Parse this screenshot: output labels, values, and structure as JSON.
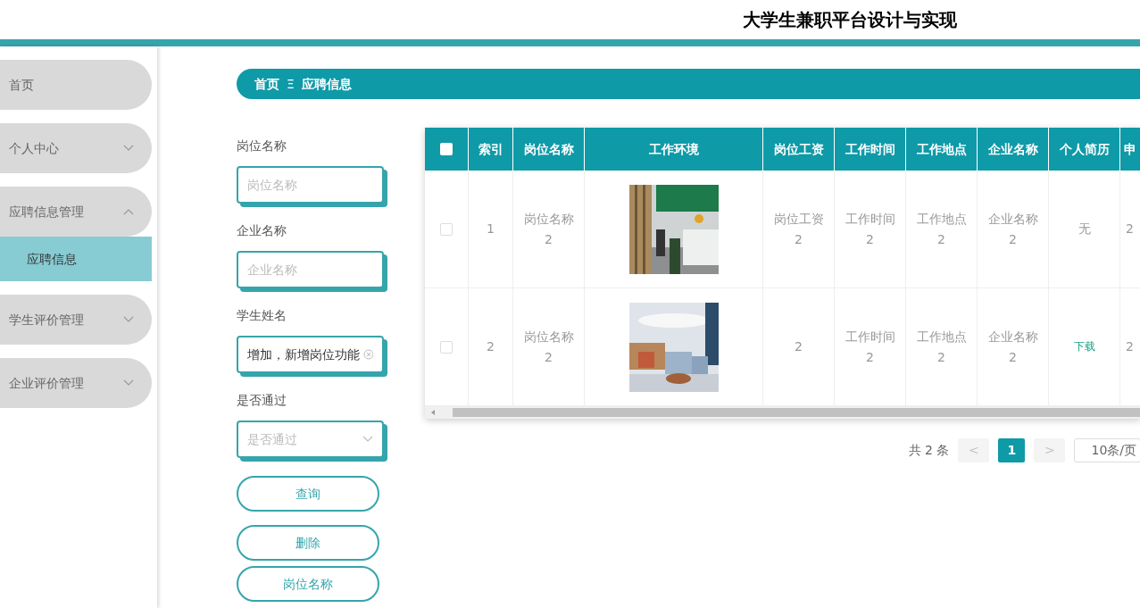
{
  "header": {
    "title": "大学生兼职平台设计与实现"
  },
  "sidebar": {
    "items": [
      {
        "label": "首页"
      },
      {
        "label": "个人中心",
        "expanded": false
      },
      {
        "label": "应聘信息管理",
        "expanded": true,
        "children": [
          {
            "label": "应聘信息",
            "selected": true
          }
        ]
      },
      {
        "label": "学生评价管理",
        "expanded": false
      },
      {
        "label": "企业评价管理",
        "expanded": false
      }
    ]
  },
  "breadcrumb": {
    "home": "首页",
    "separator": "Ξ",
    "current": "应聘信息"
  },
  "filters": [
    {
      "kind": "input",
      "label": "岗位名称",
      "placeholder": "岗位名称"
    },
    {
      "kind": "input",
      "label": "企业名称",
      "placeholder": "企业名称"
    },
    {
      "kind": "input",
      "label": "学生姓名",
      "value": "增加，新增岗位功能"
    },
    {
      "kind": "select",
      "label": "是否通过",
      "placeholder": "是否通过"
    }
  ],
  "buttons": [
    "查询",
    "删除",
    "岗位名称"
  ],
  "table": {
    "select_all_checked": false,
    "columns": [
      "索引",
      "岗位名称",
      "工作环境",
      "岗位工资",
      "工作时间",
      "工作地点",
      "企业名称",
      "个人简历",
      "申"
    ],
    "rows": [
      {
        "checked": false,
        "index": "1",
        "job_name": [
          "岗位名称",
          "2"
        ],
        "salary": [
          "岗位工资",
          "2"
        ],
        "work_time": [
          "工作时间",
          "2"
        ],
        "location": [
          "工作地点",
          "2"
        ],
        "company": [
          "企业名称",
          "2"
        ],
        "resume": {
          "kind": "text",
          "text": "无"
        },
        "column_9": "2"
      },
      {
        "checked": false,
        "index": "2",
        "job_name": [
          "岗位名称",
          "2"
        ],
        "salary": [
          "2"
        ],
        "work_time": [
          "工作时间",
          "2"
        ],
        "location": [
          "工作地点",
          "2"
        ],
        "company": [
          "企业名称",
          "2"
        ],
        "resume": {
          "kind": "link",
          "text": "下载"
        },
        "column_9": "2"
      }
    ]
  },
  "pagination": {
    "total": "共 2 条",
    "prev": "<",
    "pages": [
      {
        "label": "1",
        "selected": true
      }
    ],
    "next": ">",
    "page_size": "10条/页"
  }
}
